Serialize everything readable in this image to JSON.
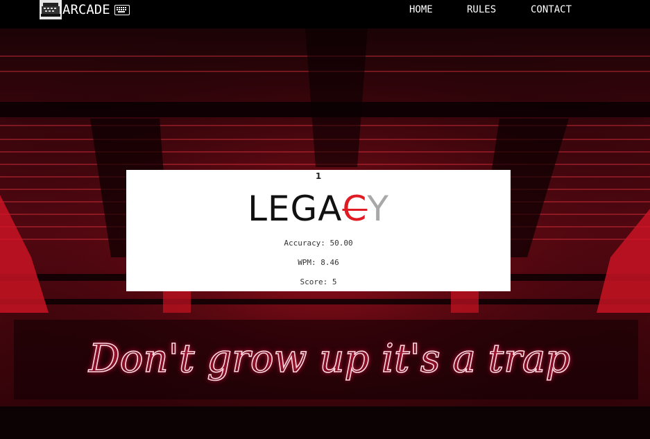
{
  "nav": {
    "brand": "ARCADE",
    "brand_icon": "keyboard-icon",
    "items": [
      {
        "label": "HOME"
      },
      {
        "label": "RULES"
      },
      {
        "label": "CONTACT"
      }
    ]
  },
  "card": {
    "rank": "1",
    "logo": {
      "part_dark": "LEGA",
      "part_red": "C",
      "part_grey": "Y"
    },
    "accuracy": "Accuracy: 50.00",
    "wpm": "WPM: 8.46",
    "score": "Score: 5"
  },
  "background": {
    "neon_text": "Don't grow up it's a trap"
  },
  "colors": {
    "nav_bg": "#000000",
    "neon": "#ff2a55",
    "logo_red": "#e01b24",
    "logo_grey": "#a8a8a8"
  }
}
